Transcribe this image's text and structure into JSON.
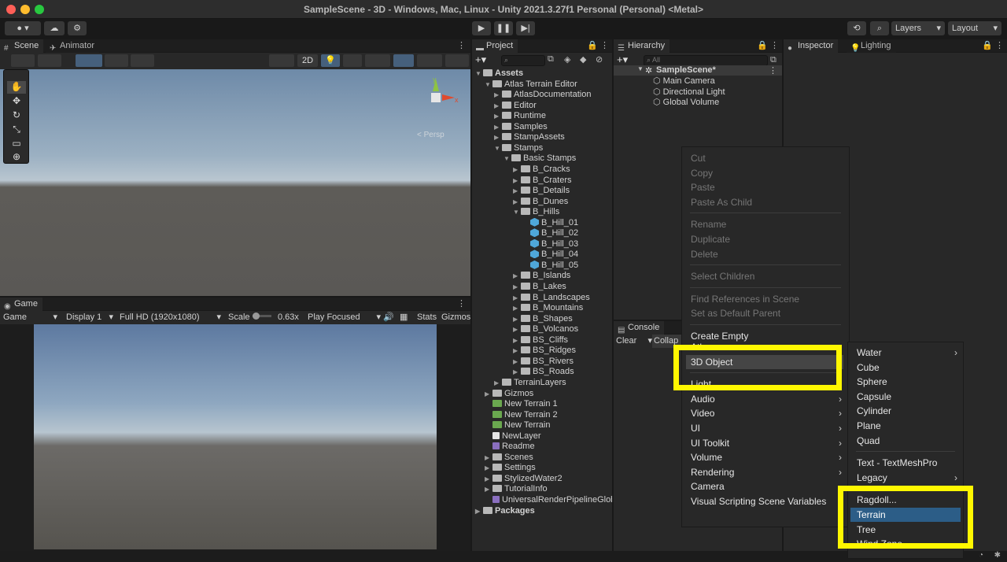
{
  "title": "SampleScene - 3D - Windows, Mac, Linux - Unity 2021.3.27f1 Personal (Personal) <Metal>",
  "toolbar": {
    "layers": "Layers",
    "layout": "Layout"
  },
  "scene": {
    "tab_scene": "Scene",
    "tab_animator": "Animator",
    "btn_2d": "2D",
    "persp": "< Persp",
    "axis_x": "x",
    "axis_y": "y"
  },
  "game": {
    "tab": "Game",
    "display_mode": "Game",
    "display": "Display 1",
    "resolution": "Full HD (1920x1080)",
    "scale_label": "Scale",
    "scale_value": "0.63x",
    "play_mode": "Play Focused",
    "stats": "Stats",
    "gizmos": "Gizmos"
  },
  "project": {
    "tab": "Project",
    "tree": [
      {
        "label": "Assets",
        "depth": 0,
        "icon": "folder",
        "open": true,
        "bold": true
      },
      {
        "label": "Atlas Terrain Editor",
        "depth": 1,
        "icon": "folder",
        "open": true
      },
      {
        "label": "AtlasDocumentation",
        "depth": 2,
        "icon": "folder"
      },
      {
        "label": "Editor",
        "depth": 2,
        "icon": "folder"
      },
      {
        "label": "Runtime",
        "depth": 2,
        "icon": "folder"
      },
      {
        "label": "Samples",
        "depth": 2,
        "icon": "folder"
      },
      {
        "label": "StampAssets",
        "depth": 2,
        "icon": "folder"
      },
      {
        "label": "Stamps",
        "depth": 2,
        "icon": "folder",
        "open": true
      },
      {
        "label": "Basic Stamps",
        "depth": 3,
        "icon": "folder",
        "open": true
      },
      {
        "label": "B_Cracks",
        "depth": 4,
        "icon": "folder"
      },
      {
        "label": "B_Craters",
        "depth": 4,
        "icon": "folder"
      },
      {
        "label": "B_Details",
        "depth": 4,
        "icon": "folder"
      },
      {
        "label": "B_Dunes",
        "depth": 4,
        "icon": "folder"
      },
      {
        "label": "B_Hills",
        "depth": 4,
        "icon": "folder",
        "open": true
      },
      {
        "label": "B_Hill_01",
        "depth": 5,
        "icon": "cube"
      },
      {
        "label": "B_Hill_02",
        "depth": 5,
        "icon": "cube"
      },
      {
        "label": "B_Hill_03",
        "depth": 5,
        "icon": "cube"
      },
      {
        "label": "B_Hill_04",
        "depth": 5,
        "icon": "cube"
      },
      {
        "label": "B_Hill_05",
        "depth": 5,
        "icon": "cube"
      },
      {
        "label": "B_Islands",
        "depth": 4,
        "icon": "folder"
      },
      {
        "label": "B_Lakes",
        "depth": 4,
        "icon": "folder"
      },
      {
        "label": "B_Landscapes",
        "depth": 4,
        "icon": "folder"
      },
      {
        "label": "B_Mountains",
        "depth": 4,
        "icon": "folder"
      },
      {
        "label": "B_Shapes",
        "depth": 4,
        "icon": "folder"
      },
      {
        "label": "B_Volcanos",
        "depth": 4,
        "icon": "folder"
      },
      {
        "label": "BS_Cliffs",
        "depth": 4,
        "icon": "folder"
      },
      {
        "label": "BS_Ridges",
        "depth": 4,
        "icon": "folder"
      },
      {
        "label": "BS_Rivers",
        "depth": 4,
        "icon": "folder"
      },
      {
        "label": "BS_Roads",
        "depth": 4,
        "icon": "folder"
      },
      {
        "label": "TerrainLayers",
        "depth": 2,
        "icon": "folder"
      },
      {
        "label": "Gizmos",
        "depth": 1,
        "icon": "folder"
      },
      {
        "label": "New Terrain 1",
        "depth": 1,
        "icon": "terrain"
      },
      {
        "label": "New Terrain 2",
        "depth": 1,
        "icon": "terrain"
      },
      {
        "label": "New Terrain",
        "depth": 1,
        "icon": "terrain"
      },
      {
        "label": "NewLayer",
        "depth": 1,
        "icon": "file"
      },
      {
        "label": "Readme",
        "depth": 1,
        "icon": "readme"
      },
      {
        "label": "Scenes",
        "depth": 1,
        "icon": "folder"
      },
      {
        "label": "Settings",
        "depth": 1,
        "icon": "folder"
      },
      {
        "label": "StylizedWater2",
        "depth": 1,
        "icon": "folder"
      },
      {
        "label": "TutorialInfo",
        "depth": 1,
        "icon": "folder"
      },
      {
        "label": "UniversalRenderPipelineGlob",
        "depth": 1,
        "icon": "readme"
      },
      {
        "label": "Packages",
        "depth": 0,
        "icon": "folder",
        "bold": true
      }
    ]
  },
  "hierarchy": {
    "tab": "Hierarchy",
    "search_placeholder": "All",
    "scene": "SampleScene*",
    "items": [
      "Main Camera",
      "Directional Light",
      "Global Volume"
    ]
  },
  "inspector": {
    "tab": "Inspector",
    "tab_lighting": "Lighting"
  },
  "console": {
    "tab": "Console",
    "clear": "Clear",
    "collapse": "Collap"
  },
  "context_menu": {
    "items": [
      {
        "label": "Cut",
        "disabled": true
      },
      {
        "label": "Copy",
        "disabled": true
      },
      {
        "label": "Paste",
        "disabled": true
      },
      {
        "label": "Paste As Child",
        "disabled": true
      },
      {
        "label": "Rename",
        "disabled": true
      },
      {
        "label": "Duplicate",
        "disabled": true
      },
      {
        "label": "Delete",
        "disabled": true
      },
      {
        "label": "Select Children",
        "disabled": true
      },
      {
        "label": "Find References in Scene",
        "disabled": true
      },
      {
        "label": "Set as Default Parent",
        "disabled": true
      },
      {
        "label": "Create Empty"
      },
      {
        "label": "Atlas"
      },
      {
        "label": "3D Object"
      },
      {
        "label": "Light",
        "sub": true
      },
      {
        "label": "Audio",
        "sub": true
      },
      {
        "label": "Video",
        "sub": true
      },
      {
        "label": "UI",
        "sub": true
      },
      {
        "label": "UI Toolkit",
        "sub": true
      },
      {
        "label": "Volume",
        "sub": true
      },
      {
        "label": "Rendering",
        "sub": true
      },
      {
        "label": "Camera"
      },
      {
        "label": "Visual Scripting Scene Variables"
      }
    ]
  },
  "submenu": {
    "items": [
      {
        "label": "Water",
        "sub": true
      },
      {
        "label": "Cube"
      },
      {
        "label": "Sphere"
      },
      {
        "label": "Capsule"
      },
      {
        "label": "Cylinder"
      },
      {
        "label": "Plane"
      },
      {
        "label": "Quad"
      },
      {
        "label": "Text - TextMeshPro"
      },
      {
        "label": "Legacy",
        "sub": true
      },
      {
        "label": "Ragdoll..."
      },
      {
        "label": "Terrain",
        "selected": true
      },
      {
        "label": "Tree"
      },
      {
        "label": "Wind Zone"
      }
    ]
  },
  "colors": {
    "highlight": "#fff700",
    "selected": "#2c5d87"
  }
}
